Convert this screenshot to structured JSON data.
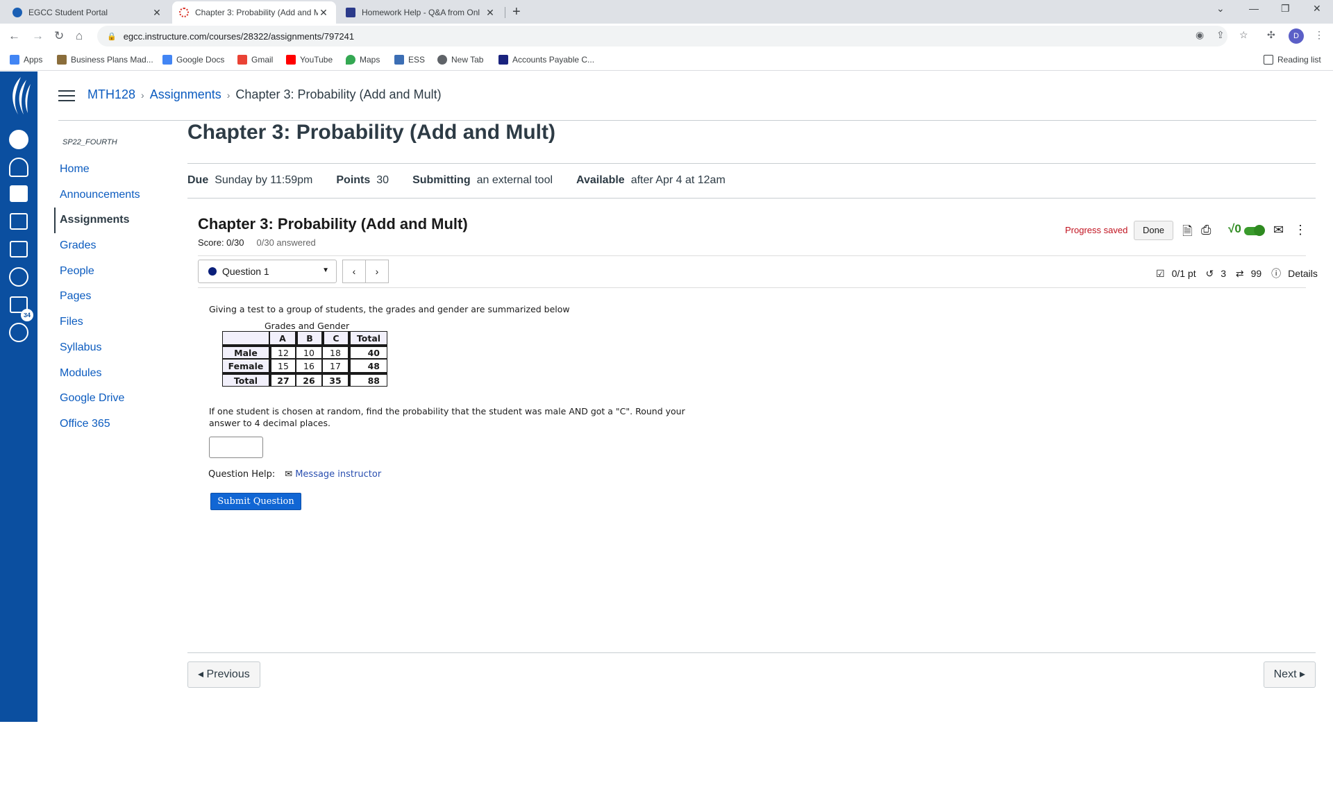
{
  "browser": {
    "tabs": [
      {
        "title": "EGCC Student Portal",
        "close": "✕",
        "color": "#1a5fb4"
      },
      {
        "title": "Chapter 3: Probability (Add and M",
        "close": "✕",
        "color": "#d93025"
      },
      {
        "title": "Homework Help - Q&A from Onl",
        "close": "✕",
        "color": "#2b3a8a"
      }
    ],
    "new_tab": "+",
    "url": "egcc.instructure.com/courses/28322/assignments/797241",
    "profile_initial": "D",
    "bookmarks": [
      {
        "label": "Apps",
        "color": "#4285f4"
      },
      {
        "label": "Business Plans Mad...",
        "color": "#8a6d3b"
      },
      {
        "label": "Google Docs",
        "color": "#4285f4"
      },
      {
        "label": "Gmail",
        "color": "#ea4335"
      },
      {
        "label": "YouTube",
        "color": "#ff0000"
      },
      {
        "label": "Maps",
        "color": "#34a853"
      },
      {
        "label": "ESS",
        "color": "#3c6eb4"
      },
      {
        "label": "New Tab",
        "color": "#5f6368"
      },
      {
        "label": "Accounts Payable C...",
        "color": "#1a237e"
      }
    ],
    "reading_list": "Reading list"
  },
  "global_nav": {
    "inbox_badge": "34",
    "accent": "#0b4fa0"
  },
  "breadcrumb": {
    "course": "MTH128",
    "section": "Assignments",
    "current": "Chapter 3: Probability (Add and Mult)"
  },
  "course_nav": {
    "term": "SP22_FOURTH",
    "items": [
      "Home",
      "Announcements",
      "Assignments",
      "Grades",
      "People",
      "Pages",
      "Files",
      "Syllabus",
      "Modules",
      "Google Drive",
      "Office 365"
    ],
    "active": "Assignments"
  },
  "assignment": {
    "title": "Chapter 3: Probability (Add and Mult)",
    "due_label": "Due",
    "due_value": "Sunday by 11:59pm",
    "points_label": "Points",
    "points_value": "30",
    "submitting_label": "Submitting",
    "submitting_value": "an external tool",
    "available_label": "Available",
    "available_value": "after Apr 4 at 12am"
  },
  "quiz": {
    "title": "Chapter 3: Probability (Add and Mult)",
    "score": "Score: 0/30",
    "answered": "0/30 answered",
    "progress": "Progress saved",
    "done": "Done",
    "question_select": "Question 1",
    "points": "0/1 pt",
    "retries": "3",
    "attempts": "99",
    "details": "Details",
    "prompt": "Giving a test to a group of students, the grades and gender are summarized below",
    "table_caption": "Grades and Gender",
    "table_header": [
      "",
      "A",
      "B",
      "C",
      "Total"
    ],
    "table_rows": [
      [
        "Male",
        "12",
        "10",
        "18",
        "40"
      ],
      [
        "Female",
        "15",
        "16",
        "17",
        "48"
      ],
      [
        "Total",
        "27",
        "26",
        "35",
        "88"
      ]
    ],
    "question": "If one student is chosen at random, find the probability that the student was male AND got a \"C\". Round your answer to 4 decimal places.",
    "answer_value": "",
    "help_label": "Question Help:",
    "message_link": "Message instructor",
    "submit": "Submit Question"
  },
  "footer": {
    "previous": "◂ Previous",
    "next": "Next ▸"
  }
}
